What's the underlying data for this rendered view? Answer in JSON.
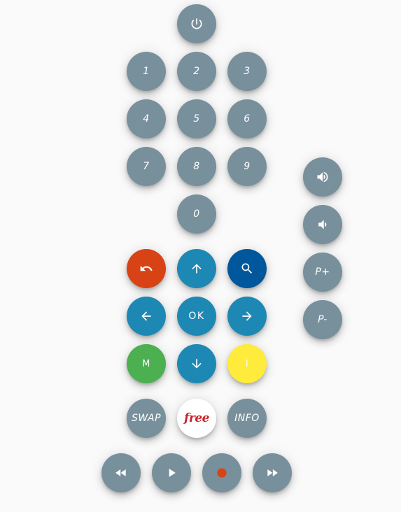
{
  "keypad": {
    "digits": [
      "1",
      "2",
      "3",
      "4",
      "5",
      "6",
      "7",
      "8",
      "9",
      "0"
    ]
  },
  "navigation": {
    "ok_label": "OK",
    "back_icon": "undo-icon",
    "up_icon": "arrow-up-icon",
    "search_icon": "search-icon",
    "left_icon": "arrow-left-icon",
    "right_icon": "arrow-right-icon",
    "down_icon": "arrow-down-icon"
  },
  "colored_keys": {
    "menu_label": "M",
    "info_label": "I"
  },
  "function_keys": {
    "swap_label": "SWAP",
    "brand_label": "free",
    "info_label": "INFO"
  },
  "side": {
    "vol_up_icon": "volume-up-icon",
    "vol_down_icon": "volume-down-icon",
    "prog_up_label": "P+",
    "prog_down_label": "P-"
  },
  "media": {
    "rewind_icon": "rewind-icon",
    "play_icon": "play-icon",
    "record_icon": "record-icon",
    "forward_icon": "fast-forward-icon"
  },
  "colors": {
    "grey": "#78909c",
    "blue": "#1e88b5",
    "dark_blue": "#01579b",
    "orange": "#d84315",
    "green": "#4caf50",
    "yellow": "#ffeb3b",
    "record": "#d84315",
    "brand_red": "#cc1f27"
  }
}
